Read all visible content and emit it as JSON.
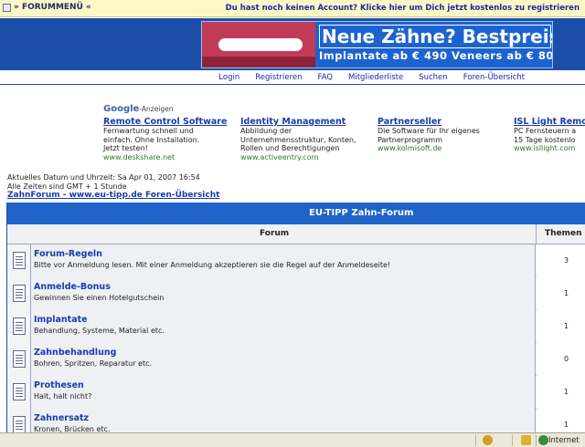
{
  "topbar": {
    "menu_label": "» FORUMMENÜ «",
    "account_text": "Du hast noch keinen Account? Klicke hier um Dich jetzt kostenlos zu registrieren"
  },
  "banner": {
    "title": "Neue Zähne? Bestpreis!",
    "subtitle": "Implantate ab € 490 Veneers ab € 80"
  },
  "nav": {
    "items": [
      "Login",
      "Registrieren",
      "FAQ",
      "Mitgliederliste",
      "Suchen",
      "Foren-Übersicht"
    ]
  },
  "ads": {
    "google_label": "Google",
    "google_suffix": "-Anzeigen",
    "items": [
      {
        "title": "Remote Control Software",
        "desc": [
          "Fernwartung schnell und",
          "einfach. Ohne Installation.",
          "Jetzt testen!"
        ],
        "url": "www.deskshare.net"
      },
      {
        "title": "Identity Management",
        "desc": [
          "Abbildung der",
          "Unternehmensstruktur, Konten,",
          "Rollen und Berechtigungen"
        ],
        "url": "www.activeentry.com"
      },
      {
        "title": "Partnerseller",
        "desc": [
          "Die Software für Ihr eigenes",
          "Partnerprogramm"
        ],
        "url": "www.kolmisoft.de"
      },
      {
        "title": "ISL Light Remo",
        "desc": [
          "PC Fernsteuern a",
          "15 Tage kostenlo"
        ],
        "url": "www.isllight.com"
      }
    ]
  },
  "info": {
    "date_line": "Aktuelles Datum und Uhrzeit: Sa Apr 01, 2007 16:54",
    "tz_line": "Alle Zeiten sind GMT + 1 Stunde",
    "breadcrumb": "ZahnForum - www.eu-tipp.de Foren-Übersicht"
  },
  "forum": {
    "caption": "EU-TIPP Zahn-Forum",
    "col_forum": "Forum",
    "col_themen": "Themen",
    "rows": [
      {
        "title": "Forum-Regeln",
        "desc": "Bitte vor Anmeldung lesen. Mit einer Anmeldung akzeptieren sie die Regel auf der Anmeldeseite!",
        "count": "3"
      },
      {
        "title": "Anmelde-Bonus",
        "desc": "Gewinnen Sie einen Hotelgutschein",
        "count": "1"
      },
      {
        "title": "Implantate",
        "desc": "Behandlung, Systeme, Material etc.",
        "count": "1"
      },
      {
        "title": "Zahnbehandlung",
        "desc": "Bohren, Spritzen, Reparatur etc.",
        "count": "0"
      },
      {
        "title": "Prothesen",
        "desc": "Halt, halt nicht?",
        "count": "1"
      },
      {
        "title": "Zahnersatz",
        "desc": "Kronen, Brücken etc.",
        "count": "1"
      }
    ]
  },
  "statusbar": {
    "zone_label": "Internet"
  }
}
